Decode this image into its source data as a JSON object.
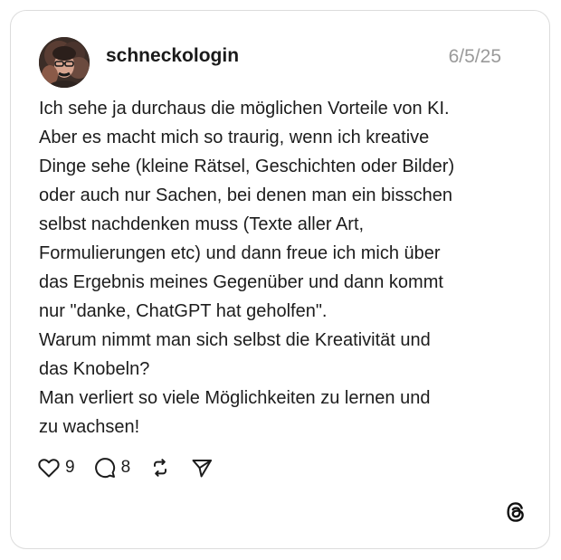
{
  "post": {
    "author": "schneckologin",
    "date": "6/5/25",
    "lines": [
      "Ich sehe ja durchaus die möglichen Vorteile von KI.",
      "Aber es macht mich so traurig, wenn ich kreative",
      "Dinge sehe (kleine Rätsel, Geschichten oder Bilder)",
      "oder auch nur Sachen, bei denen man ein bisschen",
      "selbst nachdenken muss (Texte aller Art,",
      "Formulierungen etc) und dann freue ich mich über",
      "das Ergebnis meines Gegenüber und dann kommt",
      "nur \"danke, ChatGPT hat geholfen\".",
      "Warum nimmt man sich selbst die Kreativität und",
      "das Knobeln?",
      "Man verliert so viele Möglichkeiten zu lernen und",
      "zu wachsen!"
    ]
  },
  "actions": {
    "likes": "9",
    "replies": "8",
    "like_icon": "heart-icon",
    "reply_icon": "speech-bubble-icon",
    "repost_icon": "repost-icon",
    "share_icon": "send-icon"
  },
  "branding": {
    "logo_icon": "threads-logo-icon"
  },
  "colors": {
    "text": "#1c1c1c",
    "muted": "#9a9a9a",
    "border": "#dcdcdc",
    "background": "#ffffff"
  }
}
